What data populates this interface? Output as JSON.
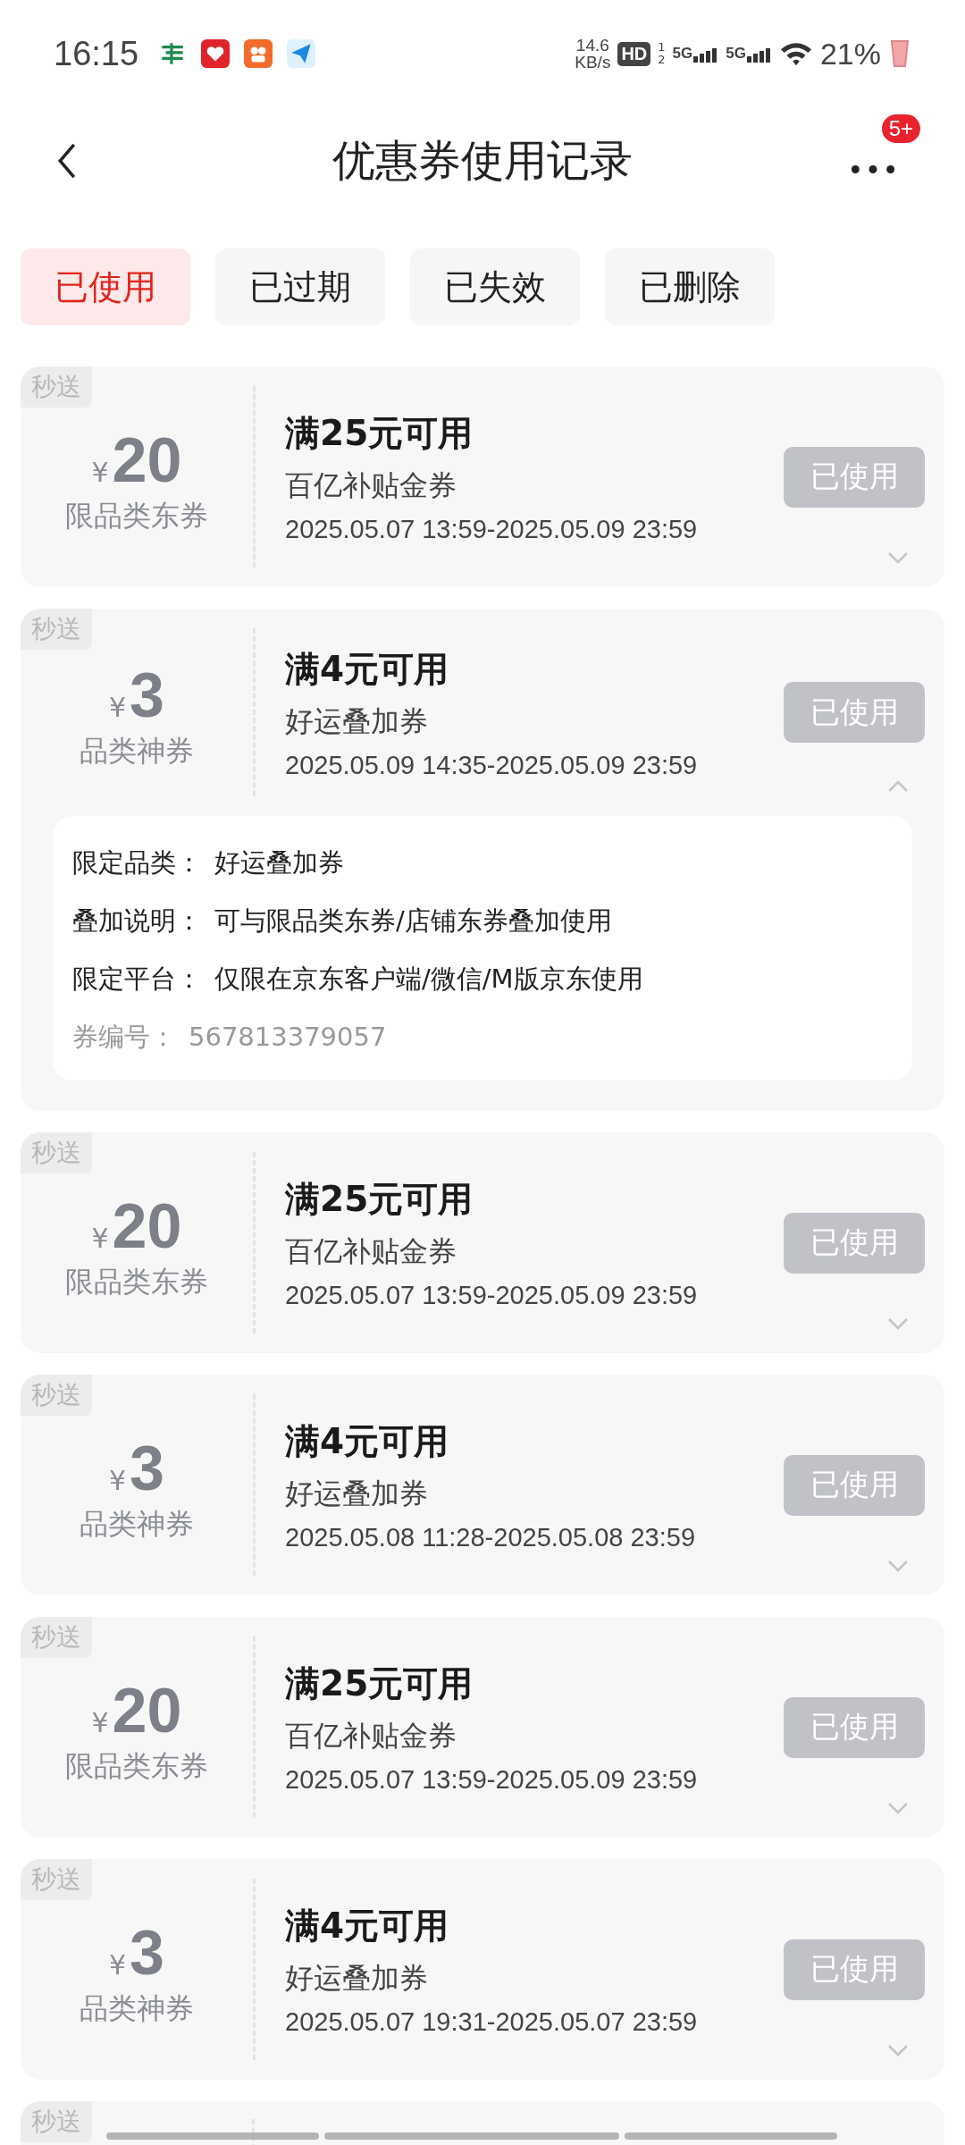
{
  "status_bar": {
    "time": "16:15",
    "speed": "14.6",
    "speed_unit": "KB/s",
    "hd": "HD",
    "sim_slots": [
      "1",
      "2"
    ],
    "networks": [
      "5G",
      "5G"
    ],
    "battery": "21%"
  },
  "header": {
    "title": "优惠券使用记录",
    "badge": "5+"
  },
  "tabs": [
    {
      "label": "已使用",
      "selected": true
    },
    {
      "label": "已过期",
      "selected": false
    },
    {
      "label": "已失效",
      "selected": false
    },
    {
      "label": "已删除",
      "selected": false
    }
  ],
  "coupons": [
    {
      "tag": "秒送",
      "currency": "¥",
      "amount": "20",
      "category": "限品类东券",
      "title": "满25元可用",
      "subtitle": "百亿补贴金券",
      "period": "2025.05.07 13:59-2025.05.09 23:59",
      "status": "已使用",
      "expanded": false
    },
    {
      "tag": "秒送",
      "currency": "¥",
      "amount": "3",
      "category": "品类神券",
      "title": "满4元可用",
      "subtitle": "好运叠加券",
      "period": "2025.05.09 14:35-2025.05.09 23:59",
      "status": "已使用",
      "expanded": true,
      "details": [
        {
          "label": "限定品类：",
          "value": "好运叠加券"
        },
        {
          "label": "叠加说明：",
          "value": "可与限品类东券/店铺东券叠加使用"
        },
        {
          "label": "限定平台：",
          "value": "仅限在京东客户端/微信/M版京东使用"
        }
      ],
      "code": {
        "label": "券编号：",
        "value": "567813379057"
      }
    },
    {
      "tag": "秒送",
      "currency": "¥",
      "amount": "20",
      "category": "限品类东券",
      "title": "满25元可用",
      "subtitle": "百亿补贴金券",
      "period": "2025.05.07 13:59-2025.05.09 23:59",
      "status": "已使用",
      "expanded": false
    },
    {
      "tag": "秒送",
      "currency": "¥",
      "amount": "3",
      "category": "品类神券",
      "title": "满4元可用",
      "subtitle": "好运叠加券",
      "period": "2025.05.08 11:28-2025.05.08 23:59",
      "status": "已使用",
      "expanded": false
    },
    {
      "tag": "秒送",
      "currency": "¥",
      "amount": "20",
      "category": "限品类东券",
      "title": "满25元可用",
      "subtitle": "百亿补贴金券",
      "period": "2025.05.07 13:59-2025.05.09 23:59",
      "status": "已使用",
      "expanded": false
    },
    {
      "tag": "秒送",
      "currency": "¥",
      "amount": "3",
      "category": "品类神券",
      "title": "满4元可用",
      "subtitle": "好运叠加券",
      "period": "2025.05.07 19:31-2025.05.07 23:59",
      "status": "已使用",
      "expanded": false
    }
  ],
  "partial_card": {
    "tag": "秒送"
  }
}
